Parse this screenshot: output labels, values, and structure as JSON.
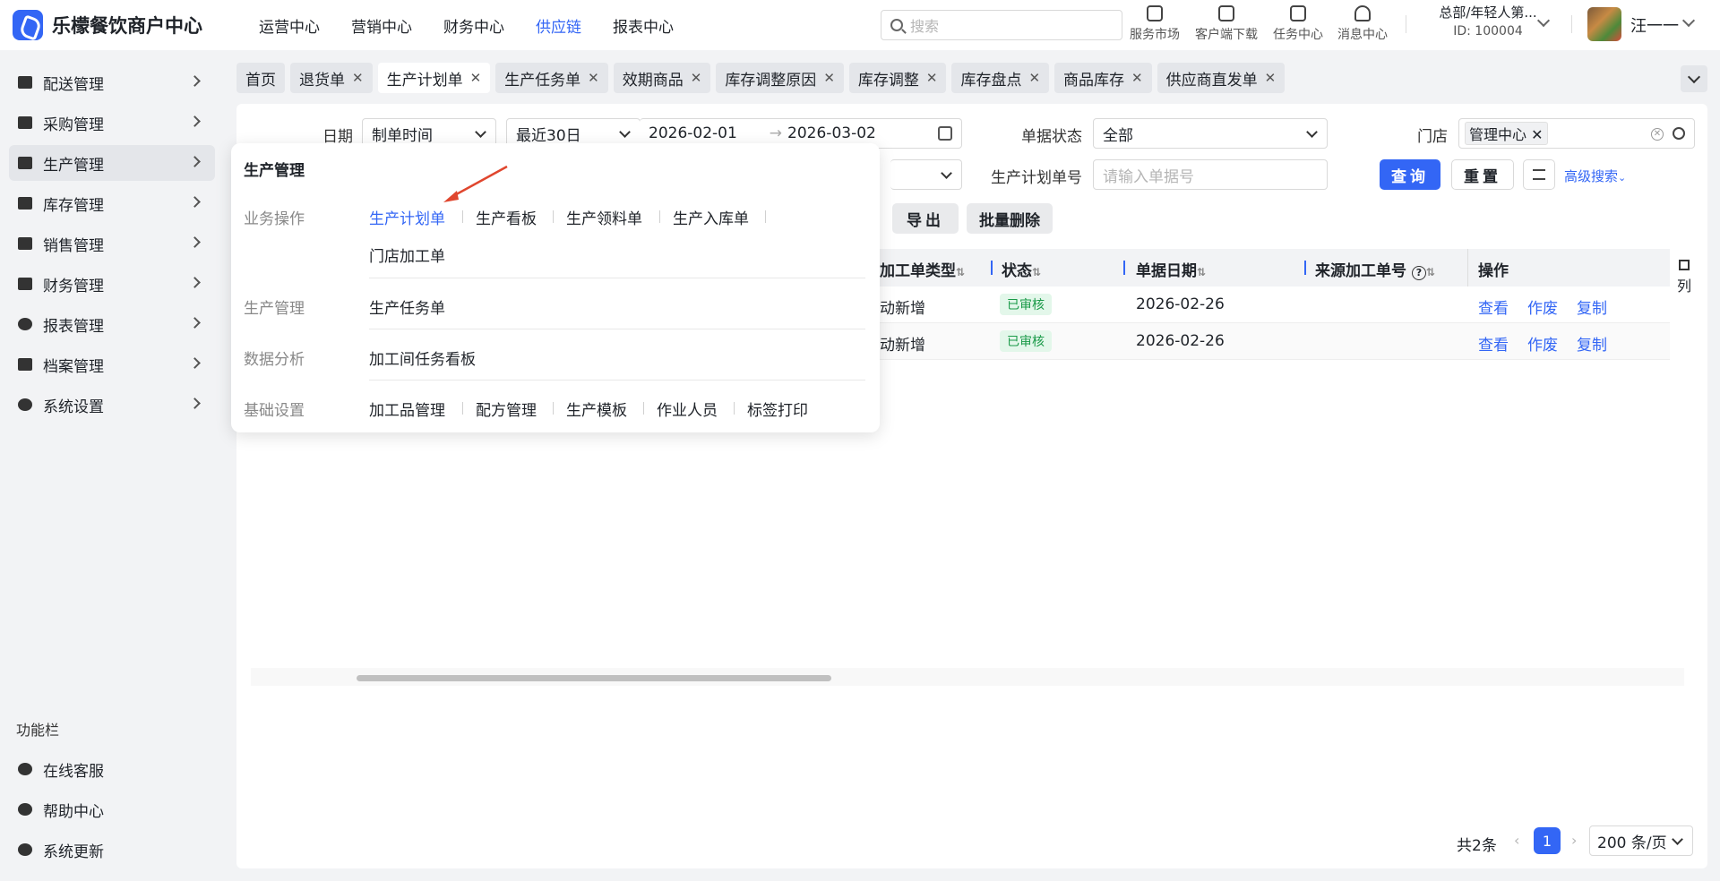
{
  "app": {
    "title": "乐檬餐饮商户中心"
  },
  "topnav": [
    "运营中心",
    "营销中心",
    "财务中心",
    "供应链",
    "报表中心"
  ],
  "topnav_active": "供应链",
  "search": {
    "placeholder": "搜索"
  },
  "tools": [
    "服务市场",
    "客户端下载",
    "任务中心",
    "消息中心"
  ],
  "org": {
    "name": "总部/年轻人第...",
    "id": "ID: 100004"
  },
  "user": {
    "name": "汪一一"
  },
  "sidebar": {
    "items": [
      "配送管理",
      "采购管理",
      "生产管理",
      "库存管理",
      "销售管理",
      "财务管理",
      "报表管理",
      "档案管理",
      "系统设置"
    ],
    "active": "生产管理",
    "func_title": "功能栏",
    "func_items": [
      "在线客服",
      "帮助中心",
      "系统更新"
    ]
  },
  "tabs": [
    "首页",
    "退货单",
    "生产计划单",
    "生产任务单",
    "效期商品",
    "库存调整原因",
    "库存调整",
    "库存盘点",
    "商品库存",
    "供应商直发单"
  ],
  "tabs_active": "生产计划单",
  "filters": {
    "date_label": "日期",
    "date_type": "制单时间",
    "date_range": "最近30日",
    "date_start": "2026-02-01",
    "date_arrow": "→",
    "date_end": "2026-03-02",
    "status_label": "单据状态",
    "status_value": "全部",
    "store_label": "门店",
    "store_tag": "管理中心",
    "plan_no_label": "生产计划单号",
    "plan_no_placeholder": "请输入单据号",
    "query_btn": "查询",
    "reset_btn": "重置",
    "advanced": "高级搜索"
  },
  "actions": {
    "export": "导出",
    "batch_delete": "批量删除"
  },
  "table": {
    "headers": [
      "加工单类型",
      "状态",
      "单据日期",
      "来源加工单号",
      "操作"
    ],
    "rows": [
      {
        "type": "动新增",
        "status": "已审核",
        "date": "2026-02-26",
        "source": "",
        "ops": [
          "查看",
          "作废",
          "复制"
        ]
      },
      {
        "type": "动新增",
        "status": "已审核",
        "date": "2026-02-26",
        "source": "",
        "ops": [
          "查看",
          "作废",
          "复制"
        ]
      }
    ],
    "column_settings": "列"
  },
  "pager": {
    "total": "共2条",
    "page": "1",
    "size": "200 条/页"
  },
  "flyout": {
    "title": "生产管理",
    "groups": [
      {
        "category": "业务操作",
        "links": [
          "生产计划单",
          "生产看板",
          "生产领料单",
          "生产入库单",
          "门店加工单"
        ]
      },
      {
        "category": "生产管理",
        "links": [
          "生产任务单"
        ]
      },
      {
        "category": "数据分析",
        "links": [
          "加工间任务看板"
        ]
      },
      {
        "category": "基础设置",
        "links": [
          "加工品管理",
          "配方管理",
          "生产模板",
          "作业人员",
          "标签打印"
        ]
      }
    ],
    "active_link": "生产计划单"
  },
  "colors": {
    "accent": "#3366f5",
    "status_green": "#1a9a48",
    "arrow_red": "#e0462e"
  }
}
